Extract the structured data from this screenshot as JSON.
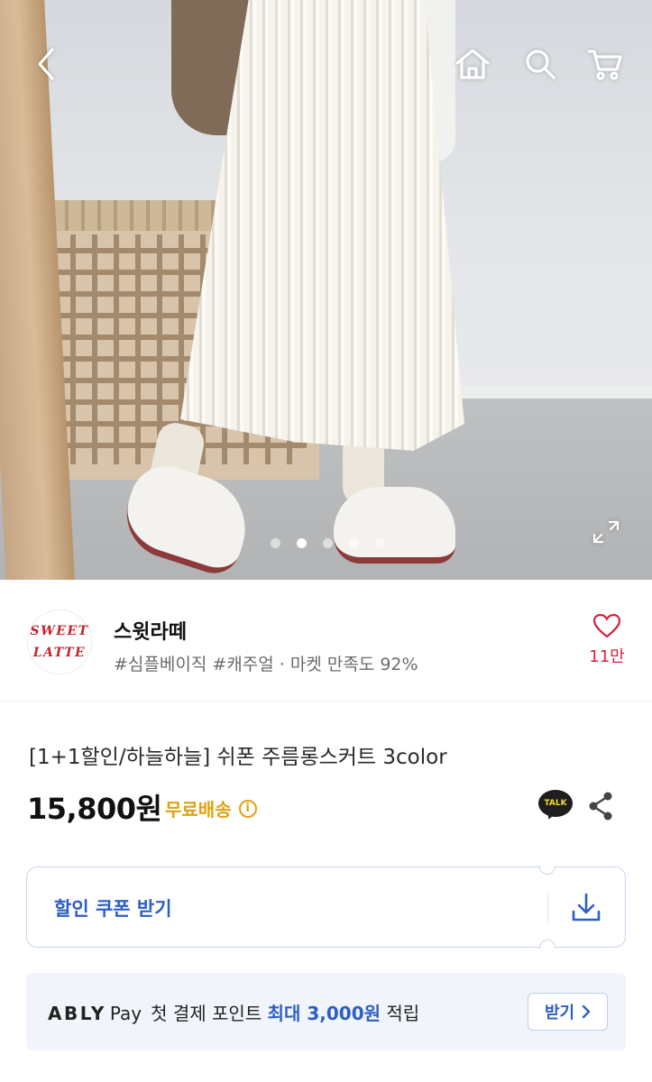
{
  "hero": {
    "alt": "product photo",
    "slide_count": 5,
    "active_slide": 2
  },
  "nav": {
    "back_icon": "chevron-left-icon",
    "home_icon": "home-icon",
    "search_icon": "search-icon",
    "cart_icon": "cart-icon",
    "expand_icon": "expand-icon"
  },
  "store": {
    "logo_line1": "SWEET",
    "logo_line2": "LATTE",
    "name": "스윗라떼",
    "tags": "#심플베이직 #캐주얼 · 마켓 만족도 92%",
    "like_count": "11만",
    "like_icon": "heart-icon"
  },
  "product": {
    "title": "[1+1할인/하늘하늘] 쉬폰 주름롱스커트 3color",
    "price": "15,800원",
    "shipping": "무료배송",
    "talk_label": "TALK"
  },
  "coupon": {
    "label": "할인 쿠폰 받기",
    "download_icon": "download-icon"
  },
  "ably_pay": {
    "brand": "ABLY",
    "pay": "Pay",
    "text_before": "첫 결제 포인트 ",
    "highlight": "최대 3,000원",
    "text_after": " 적립",
    "button_label": "받기"
  },
  "colors": {
    "accent_blue": "#2c5fc4",
    "like_red": "#d7203e",
    "shipping_gold": "#e0a210",
    "brand_red": "#c2262c"
  }
}
